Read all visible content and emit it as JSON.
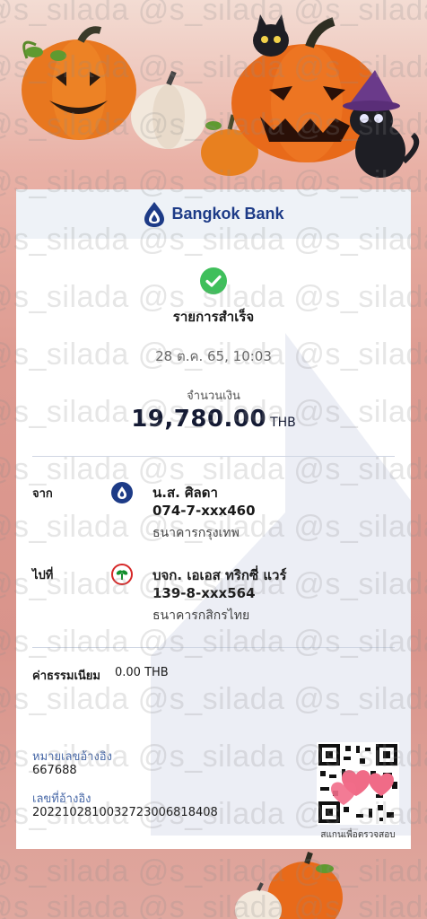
{
  "header": {
    "brand": "Bangkok Bank"
  },
  "status": {
    "title": "รายการสำเร็จ",
    "datetime": "28 ต.ค. 65, 10:03"
  },
  "amount": {
    "label": "จำนวนเงิน",
    "value": "19,780.00",
    "currency": "THB"
  },
  "from": {
    "label": "จาก",
    "name": "น.ส. ศิลดา",
    "account": "074-7-xxx460",
    "bank": "ธนาคารกรุงเทพ",
    "icon": "bangkok-bank-logo",
    "color": "#1d3b87"
  },
  "to": {
    "label": "ไปที่",
    "name": "บจก. เอเอส ทริกซี่ แวร์",
    "account": "139-8-xxx564",
    "bank": "ธนาคารกสิกรไทย",
    "icon": "kasikorn-bank-logo",
    "color": "#138f2d"
  },
  "fee": {
    "label": "ค่าธรรมเนียม",
    "value": "0.00 THB"
  },
  "reference": {
    "ref_label": "หมายเลขอ้างอิง",
    "ref_value": "667688",
    "ref_no_label": "เลขที่อ้างอิง",
    "ref_no_value": "20221028100327230068184​08"
  },
  "qr": {
    "caption": "สแกนเพื่อตรวจสอบ"
  },
  "watermark": "@s_silada @s_silada @s_silada @s_silada",
  "colors": {
    "brand": "#1d3b87",
    "success": "#3fbf5b",
    "accent_ref": "#4a6aa8"
  }
}
